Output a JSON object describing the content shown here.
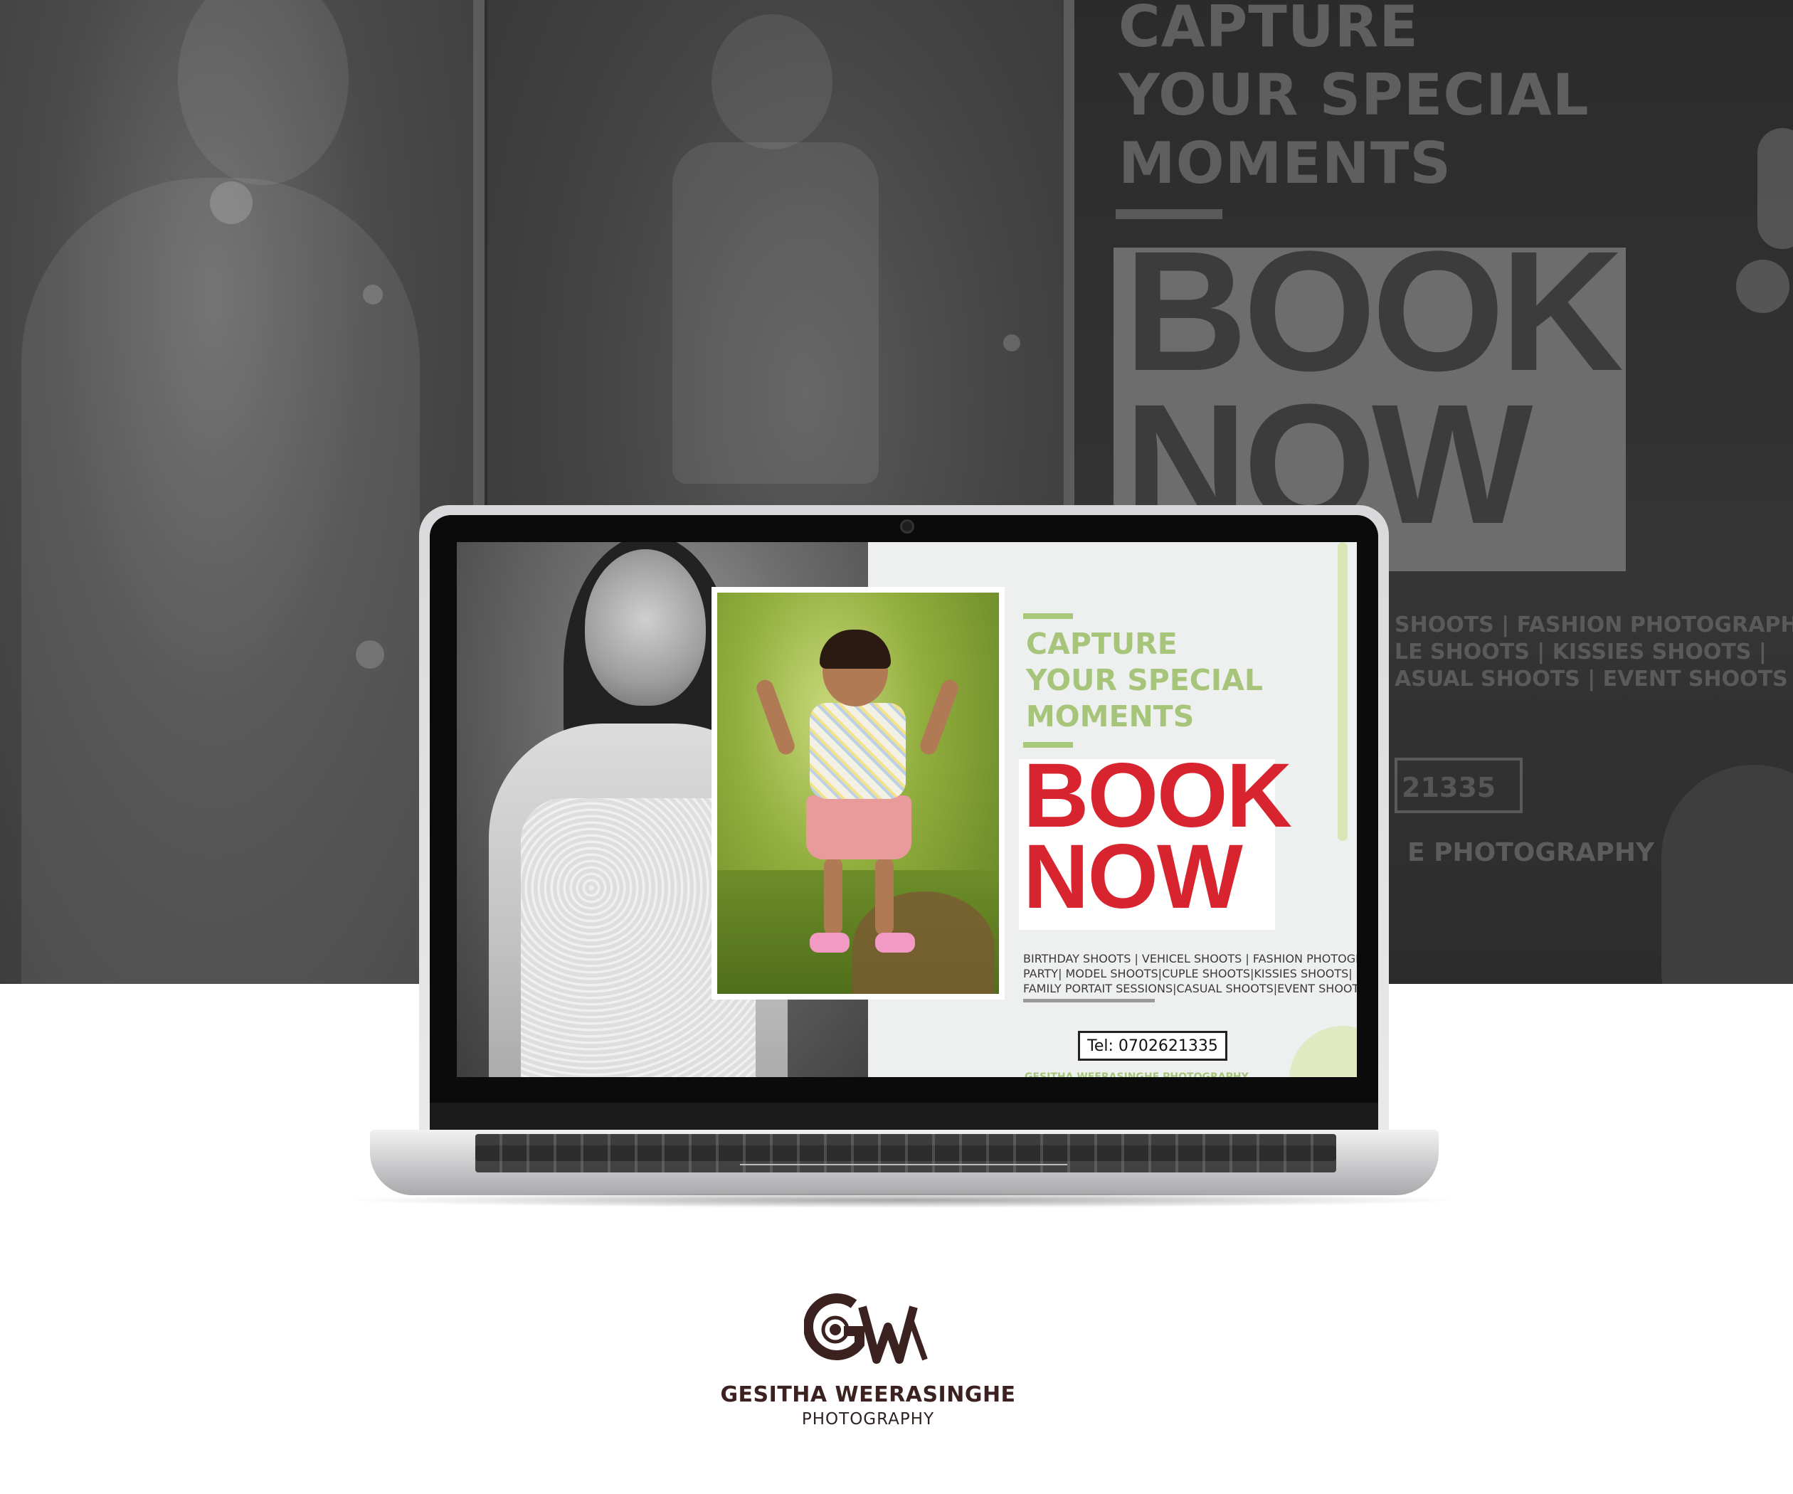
{
  "banner": {
    "heading_lines": [
      "CAPTURE",
      "YOUR SPECIAL",
      "MOMENTS"
    ],
    "book_line1": "BOOK",
    "book_line2": "NOW",
    "services_fragment": "SHOOTS | FASHION PHOTOGRAPHY\nLE SHOOTS | KISSIES SHOOTS |\nASUAL SHOOTS | EVENT SHOOTS",
    "tel_fragment": "21335",
    "photography_fragment": "E PHOTOGRAPHY"
  },
  "screen": {
    "heading_lines": [
      "CAPTURE",
      "YOUR SPECIAL",
      "MOMENTS"
    ],
    "book_line1": "BOOK",
    "book_line2": "NOW",
    "services": "BIRTHDAY SHOOTS | VEHICEL SHOOTS | FASHION PHOTOGRAPHY\nPARTY| MODEL SHOOTS|CUPLE SHOOTS|KISSIES SHOOTS|\nFAMILY PORTAIT SESSIONS|CASUAL SHOOTS|EVENT SHOOTS",
    "tel": "Tel: 0702621335",
    "footer_peek": "GESITHA WEERASINGHE PHOTOGRAPHY",
    "accent_green": "#a7c57a",
    "accent_red": "#d8242f"
  },
  "brand": {
    "logo_icon": "gw-camera-logo-icon",
    "logo_text": "GW",
    "name": "GESITHA WEERASINGHE",
    "sub": "PHOTOGRAPHY",
    "color": "#3b2220"
  }
}
